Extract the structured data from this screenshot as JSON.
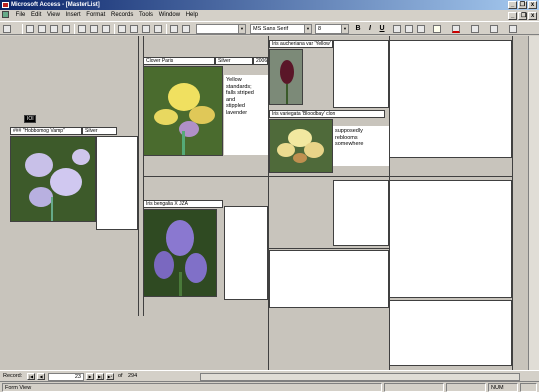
{
  "window": {
    "title": "Microsoft Access - [MasterList]",
    "minimize": "_",
    "restore": "❐",
    "close": "x"
  },
  "menu": [
    "File",
    "Edit",
    "View",
    "Insert",
    "Format",
    "Records",
    "Tools",
    "Window",
    "Help"
  ],
  "doc_controls": {
    "minimize": "_",
    "restore": "❐",
    "close": "x"
  },
  "toolbar": {
    "font_name": "MS Sans Serif",
    "font_size": "8",
    "bold": "B",
    "italic": "I",
    "underline": "U"
  },
  "records": [
    {
      "name": "### \"Hobbomog Vamp\"",
      "color": "Silver",
      "tag": "IOI"
    },
    {
      "name": "Clover Paris",
      "color": "Silver",
      "year": "2006",
      "description": "Yellow\nstandards;\nfalls striped\nand\nstippled\nlavender"
    },
    {
      "name": "Iris aucheriana var 'Yellow'"
    },
    {
      "name": "Iris variegata 'Bloodbay' clon",
      "description": "supposedly\nreblooms\nsomewhere"
    },
    {
      "name": "Iris bengalia X JZA"
    }
  ],
  "nav": {
    "label": "Record:",
    "current": "23",
    "of_label": "of",
    "total": "294"
  },
  "status": {
    "left": "Form View",
    "num": "NUM"
  }
}
